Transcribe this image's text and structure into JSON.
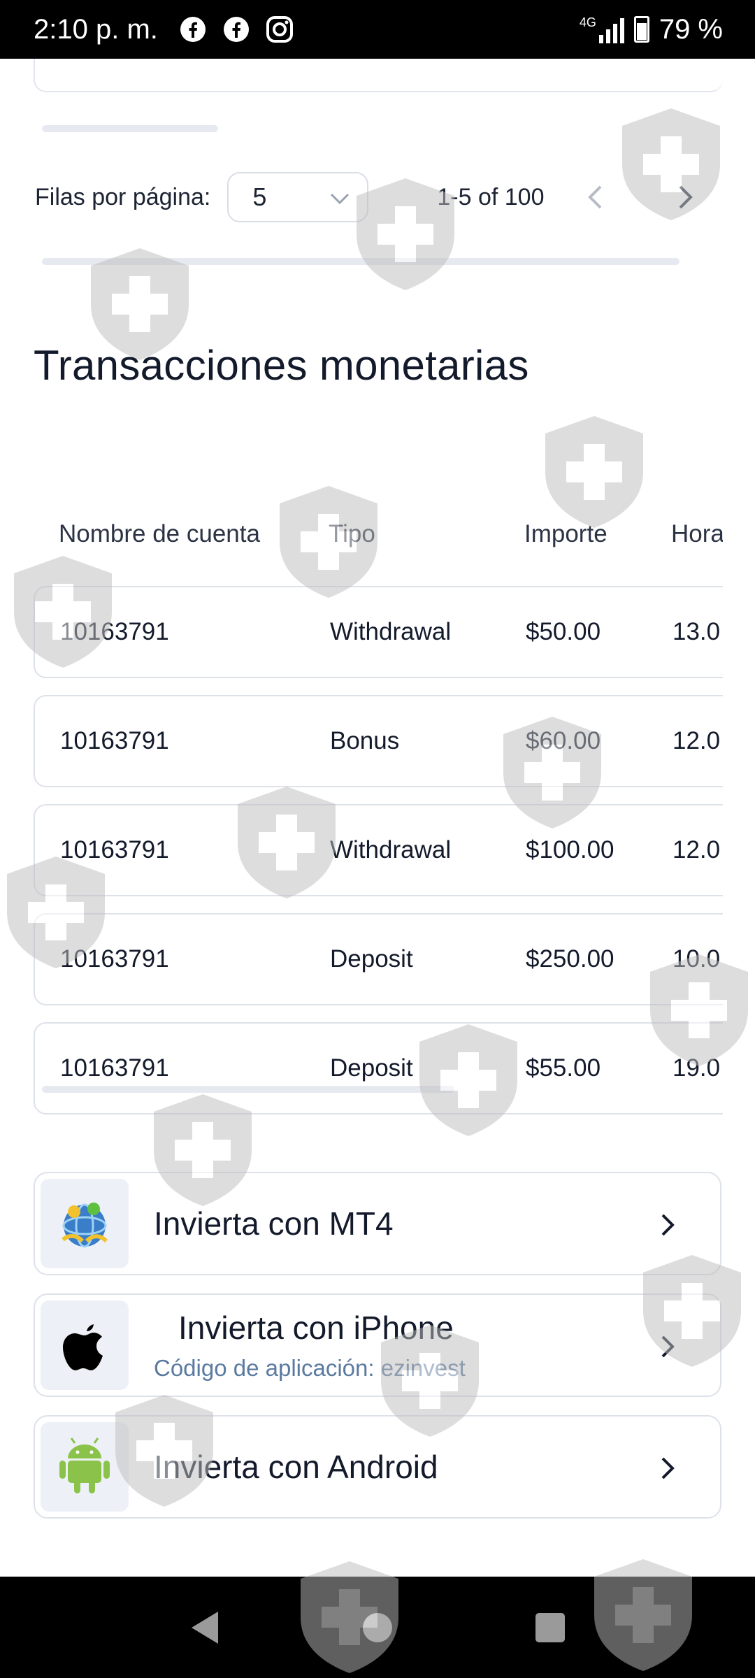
{
  "status_bar": {
    "time": "2:10 p. m.",
    "battery": "79 %",
    "network": "4G",
    "icons": [
      "facebook-icon",
      "facebook-icon",
      "instagram-icon",
      "signal-icon",
      "battery-icon"
    ]
  },
  "pagination": {
    "rows_label": "Filas por página:",
    "rows_value": "5",
    "range_text": "1-5 of 100"
  },
  "transactions": {
    "title": "Transacciones monetarias",
    "headers": [
      "Nombre de cuenta",
      "Tipo",
      "Importe",
      "Hora"
    ],
    "rows": [
      {
        "account": "10163791",
        "type": "Withdrawal",
        "amount": "$50.00",
        "time": "13.0"
      },
      {
        "account": "10163791",
        "type": "Bonus",
        "amount": "$60.00",
        "time": "12.0"
      },
      {
        "account": "10163791",
        "type": "Withdrawal",
        "amount": "$100.00",
        "time": "12.0"
      },
      {
        "account": "10163791",
        "type": "Deposit",
        "amount": "$250.00",
        "time": "10.0"
      },
      {
        "account": "10163791",
        "type": "Deposit",
        "amount": "$55.00",
        "time": "19.0"
      }
    ]
  },
  "apps": [
    {
      "title": "Invierta con MT4",
      "icon": "mt4-icon"
    },
    {
      "title": "Invierta con iPhone",
      "subtitle": "Código de aplicación: ezinvest",
      "icon": "apple-icon"
    },
    {
      "title": "Invierta con Android",
      "icon": "android-icon"
    }
  ],
  "colors": {
    "text": "#131a2b",
    "subtitle": "#5b7aa0",
    "border": "#dde1ea",
    "android_green": "#8bc34a"
  }
}
